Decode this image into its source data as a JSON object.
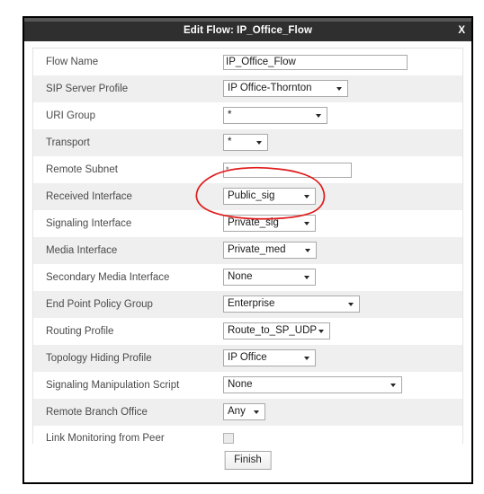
{
  "dialog": {
    "title": "Edit Flow: IP_Office_Flow",
    "close_label": "X"
  },
  "colors": {
    "titlebar_bg": "#2f2f2f",
    "titlebar_top_strip": "#575757",
    "row_alt_bg": "#efefef",
    "label_text": "#4a4a4a",
    "annotation": "#e01b1b"
  },
  "form": {
    "rows": [
      {
        "label": "Flow Name",
        "control": "text",
        "value": "IP_Office_Flow"
      },
      {
        "label": "SIP Server Profile",
        "control": "select",
        "value": "IP Office-Thornton"
      },
      {
        "label": "URI Group",
        "control": "select",
        "value": "*"
      },
      {
        "label": "Transport",
        "control": "select",
        "value": "*"
      },
      {
        "label": "Remote Subnet",
        "control": "text",
        "value": "*"
      },
      {
        "label": "Received Interface",
        "control": "select",
        "value": "Public_sig"
      },
      {
        "label": "Signaling Interface",
        "control": "select",
        "value": "Private_sig"
      },
      {
        "label": "Media Interface",
        "control": "select",
        "value": "Private_med"
      },
      {
        "label": "Secondary Media Interface",
        "control": "select",
        "value": "None"
      },
      {
        "label": "End Point Policy Group",
        "control": "select",
        "value": "Enterprise"
      },
      {
        "label": "Routing Profile",
        "control": "select",
        "value": "Route_to_SP_UDP"
      },
      {
        "label": "Topology Hiding Profile",
        "control": "select",
        "value": "IP Office"
      },
      {
        "label": "Signaling Manipulation Script",
        "control": "select",
        "value": "None"
      },
      {
        "label": "Remote Branch Office",
        "control": "select",
        "value": "Any"
      },
      {
        "label": "Link Monitoring from Peer",
        "control": "checkbox",
        "value": ""
      }
    ]
  },
  "footer": {
    "finish_label": "Finish"
  },
  "annotation": {
    "shape": "hand-drawn-ellipse",
    "target": "Received Interface dropdown (Public_sig)"
  }
}
